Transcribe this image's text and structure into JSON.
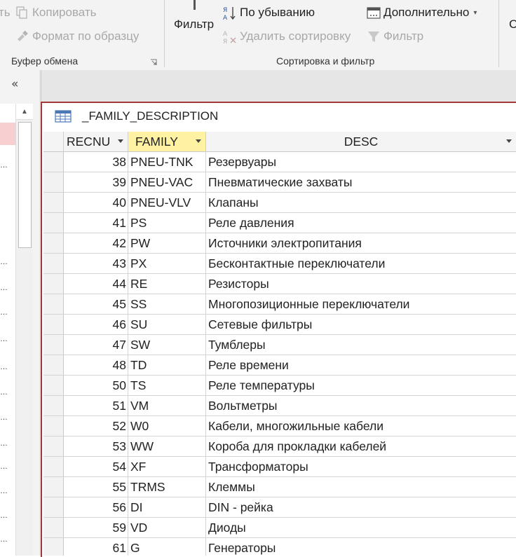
{
  "ribbon": {
    "copy_label": "Копировать",
    "format_painter_label": "Формат по образцу",
    "clipboard_group": "Буфер обмена",
    "filter_label": "Фильтр",
    "descending_label": "По убыванию",
    "remove_sort_label": "Удалить сортировку",
    "advanced_label": "Дополнительно",
    "toggle_filter_label": "Фильтр",
    "sort_filter_group": "Сортировка и фильтр",
    "cut_fragment": "ть",
    "next_group_fragment": "С"
  },
  "nav": {
    "collapse_glyph": "«"
  },
  "document": {
    "title": "_FAMILY_DESCRIPTION"
  },
  "table": {
    "columns": [
      {
        "label": "RECNU"
      },
      {
        "label": "FAMILY"
      },
      {
        "label": "DESC"
      }
    ],
    "rows": [
      {
        "recnu": "38",
        "family": "PNEU-TNK",
        "desc": "Резервуары"
      },
      {
        "recnu": "39",
        "family": "PNEU-VAC",
        "desc": "Пневматические захваты"
      },
      {
        "recnu": "40",
        "family": "PNEU-VLV",
        "desc": "Клапаны"
      },
      {
        "recnu": "41",
        "family": "PS",
        "desc": "Реле давления"
      },
      {
        "recnu": "42",
        "family": "PW",
        "desc": "Источники электропитания"
      },
      {
        "recnu": "43",
        "family": "PX",
        "desc": "Бесконтактные переключатели"
      },
      {
        "recnu": "44",
        "family": "RE",
        "desc": "Резисторы"
      },
      {
        "recnu": "45",
        "family": "SS",
        "desc": "Многопозиционные переключатели"
      },
      {
        "recnu": "46",
        "family": "SU",
        "desc": "Сетевые фильтры"
      },
      {
        "recnu": "47",
        "family": "SW",
        "desc": "Тумблеры"
      },
      {
        "recnu": "48",
        "family": "TD",
        "desc": "Реле времени"
      },
      {
        "recnu": "50",
        "family": "TS",
        "desc": "Реле температуры"
      },
      {
        "recnu": "51",
        "family": "VM",
        "desc": "Вольтметры"
      },
      {
        "recnu": "52",
        "family": "W0",
        "desc": "Кабели, многожильные кабели"
      },
      {
        "recnu": "53",
        "family": "WW",
        "desc": "Короба для прокладки кабелей"
      },
      {
        "recnu": "54",
        "family": "XF",
        "desc": "Трансформаторы"
      },
      {
        "recnu": "55",
        "family": "TRMS",
        "desc": "Клеммы"
      },
      {
        "recnu": "56",
        "family": "DI",
        "desc": "DIN - рейка"
      },
      {
        "recnu": "59",
        "family": "VD",
        "desc": "Диоды"
      },
      {
        "recnu": "61",
        "family": "G",
        "desc": "Генераторы"
      }
    ]
  },
  "colors": {
    "active_border": "#a4373a",
    "selected_header": "#fff2a2",
    "nav_selected": "#f7cfd1",
    "disabled_text": "#a8a8a8"
  },
  "icons": [
    "copy-icon",
    "format-painter-icon",
    "filter-icon",
    "sort-descending-icon",
    "remove-sort-icon",
    "advanced-filter-icon",
    "toggle-filter-icon",
    "table-icon",
    "collapse-icon"
  ]
}
